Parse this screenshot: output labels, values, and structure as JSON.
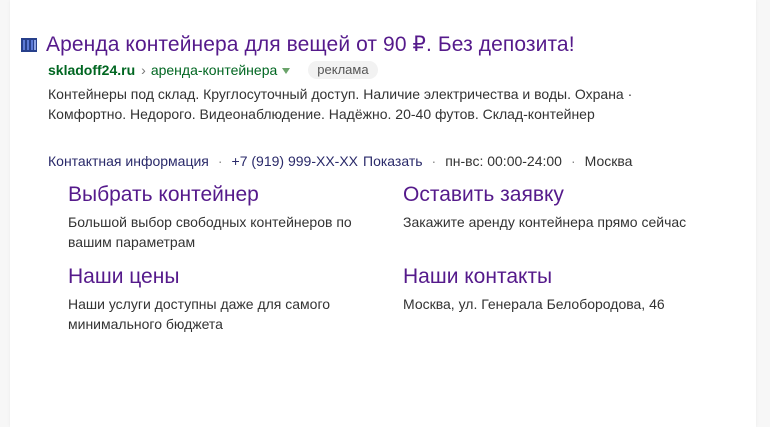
{
  "ad": {
    "title": "Аренда контейнера для вещей от 90 ₽. Без депозита!",
    "domain": "skladoff24.ru",
    "separator": "›",
    "path": "аренда-контейнера",
    "badge": "реклама",
    "description": "Контейнеры под склад. Круглосуточный доступ. Наличие электричества и воды. Охрана · Комфортно. Недорого. Видеонаблюдение. Надёжно. 20-40 футов. Склад-контейнер",
    "contacts": {
      "contact_info_label": "Контактная информация",
      "phone": "+7 (919) 999-XX-XX",
      "show_label": "Показать",
      "hours": "пн-вс: 00:00-24:00",
      "city": "Москва",
      "dot": "·"
    },
    "sitelinks": [
      {
        "title": "Выбрать контейнер",
        "description": "Большой выбор свободных контейнеров по вашим параметрам"
      },
      {
        "title": "Оставить заявку",
        "description": "Закажите аренду контейнера прямо сейчас"
      },
      {
        "title": "Наши цены",
        "description": "Наши услуги доступны даже для самого минимального бюджета"
      },
      {
        "title": "Наши контакты",
        "description": "Москва, ул. Генерала Белобородова, 46"
      }
    ]
  },
  "colors": {
    "title": "#551a8b",
    "domain": "#006621",
    "text": "#333333"
  },
  "icons": {
    "favicon": "container-favicon-icon",
    "caret": "caret-down-icon"
  }
}
